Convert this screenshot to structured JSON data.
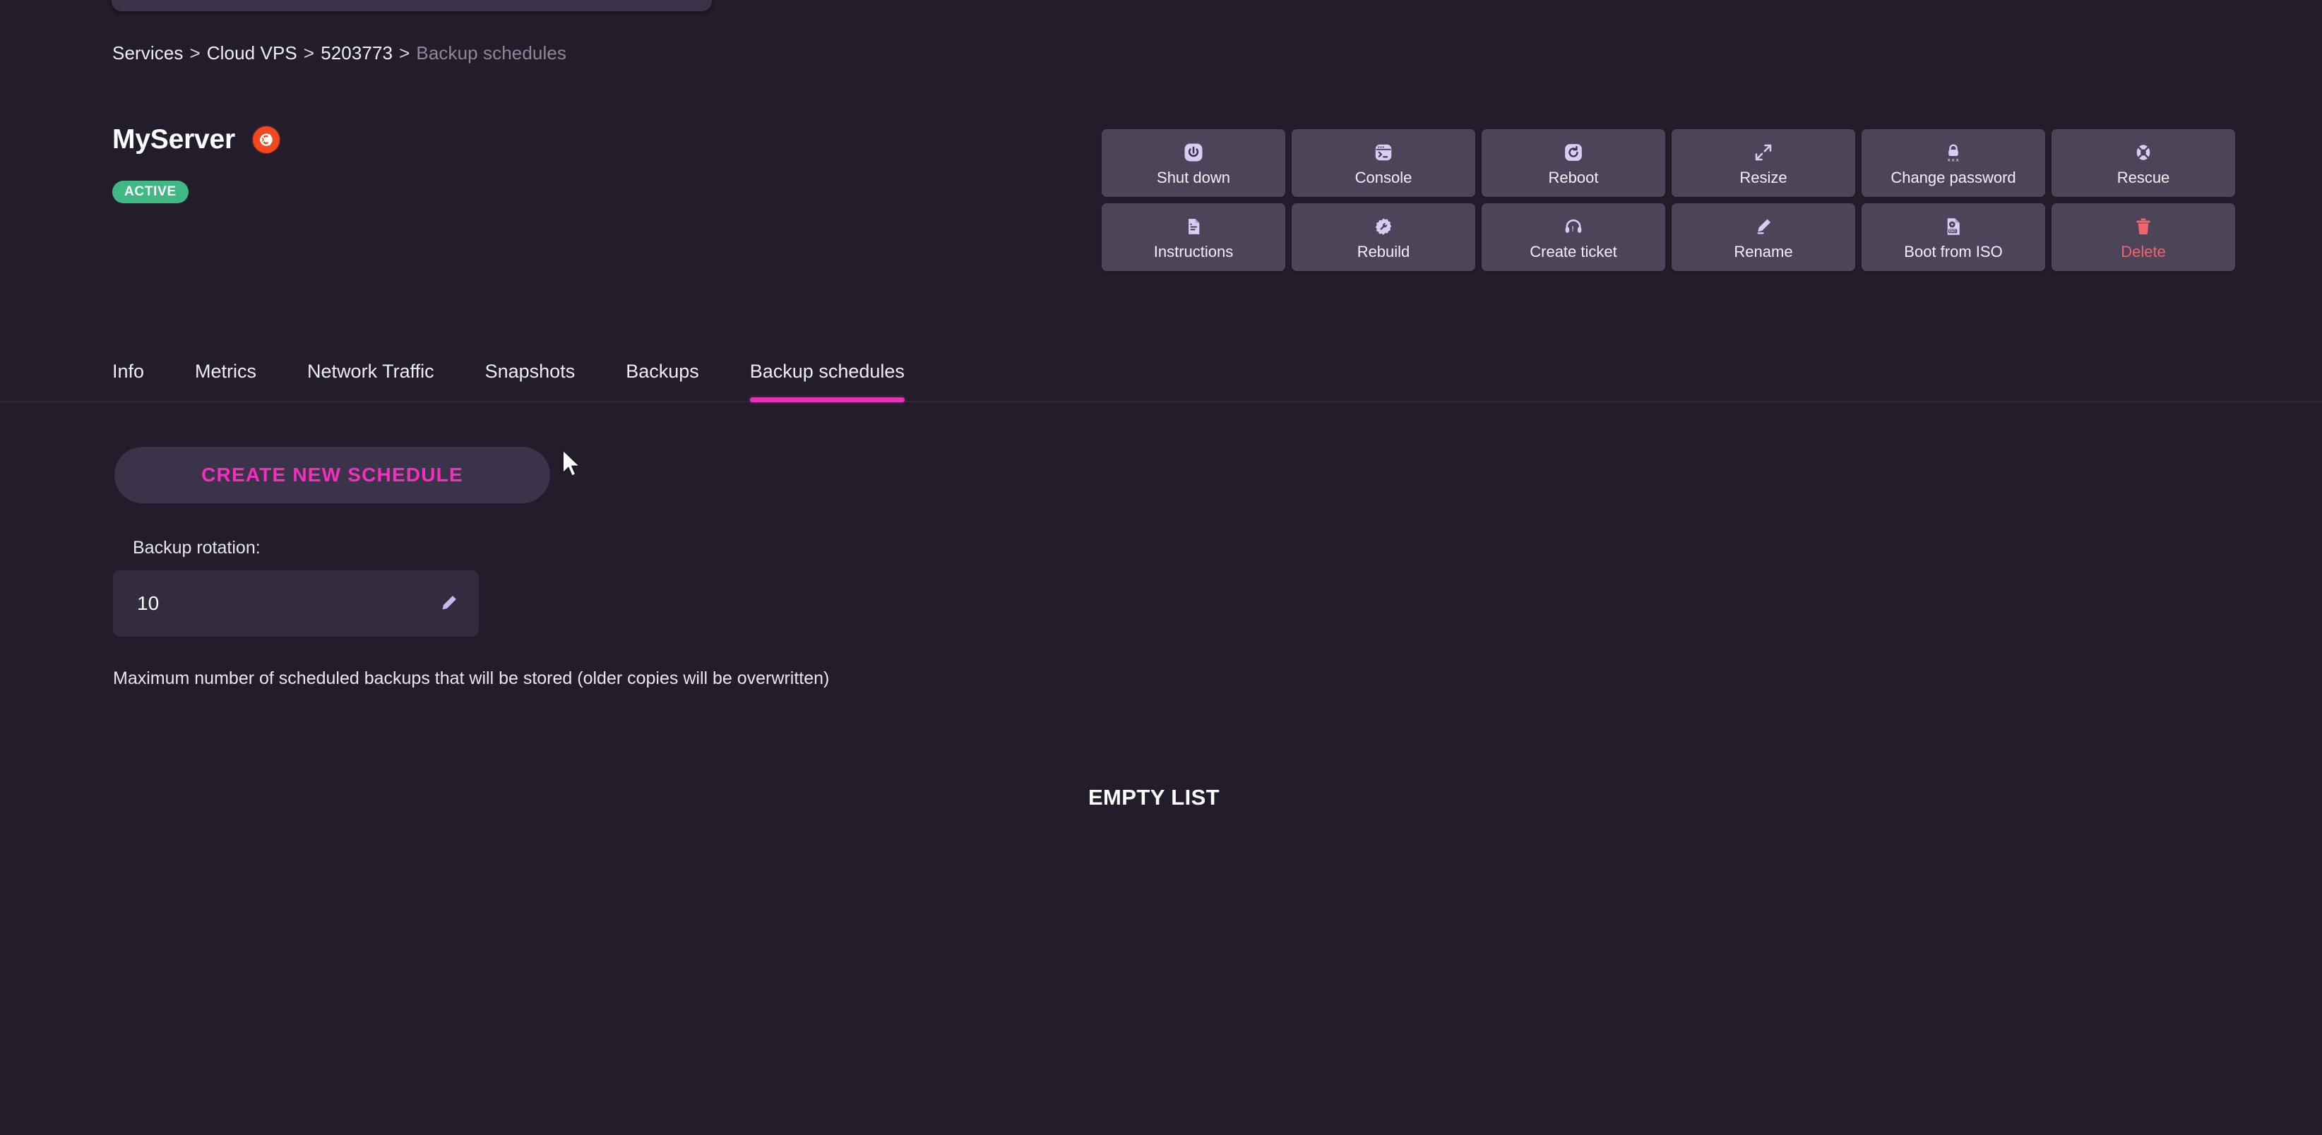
{
  "breadcrumb": {
    "items": [
      {
        "label": "Services",
        "muted": false
      },
      {
        "label": "Cloud VPS",
        "muted": false
      },
      {
        "label": "5203773",
        "muted": false
      },
      {
        "label": "Backup schedules",
        "muted": true
      }
    ],
    "separator": ">"
  },
  "server": {
    "name": "MyServer",
    "os_icon": "ubuntu-logo-icon",
    "status": "ACTIVE",
    "status_color": "#3fb883"
  },
  "actions": [
    {
      "label": "Shut down",
      "icon": "power-icon",
      "danger": false
    },
    {
      "label": "Console",
      "icon": "terminal-icon",
      "danger": false
    },
    {
      "label": "Reboot",
      "icon": "restart-icon",
      "danger": false
    },
    {
      "label": "Resize",
      "icon": "expand-icon",
      "danger": false
    },
    {
      "label": "Change password",
      "icon": "lock-icon",
      "danger": false
    },
    {
      "label": "Rescue",
      "icon": "lifebuoy-icon",
      "danger": false
    },
    {
      "label": "Instructions",
      "icon": "document-icon",
      "danger": false
    },
    {
      "label": "Rebuild",
      "icon": "gear-wrench-icon",
      "danger": false
    },
    {
      "label": "Create ticket",
      "icon": "headset-icon",
      "danger": false
    },
    {
      "label": "Rename",
      "icon": "pencil-icon",
      "danger": false
    },
    {
      "label": "Boot from ISO",
      "icon": "iso-file-icon",
      "danger": false
    },
    {
      "label": "Delete",
      "icon": "trash-icon",
      "danger": true
    }
  ],
  "tabs": [
    {
      "label": "Info",
      "active": false
    },
    {
      "label": "Metrics",
      "active": false
    },
    {
      "label": "Network Traffic",
      "active": false
    },
    {
      "label": "Snapshots",
      "active": false
    },
    {
      "label": "Backups",
      "active": false
    },
    {
      "label": "Backup schedules",
      "active": true
    }
  ],
  "accent_color": "#ef2eb7",
  "content": {
    "create_button": "Create new schedule",
    "rotation_label": "Backup rotation:",
    "rotation_value": "10",
    "rotation_edit_icon": "pencil-icon",
    "helper_text": "Maximum number of scheduled backups that will be stored (older copies will be overwritten)",
    "empty_state": "EMPTY LIST"
  }
}
